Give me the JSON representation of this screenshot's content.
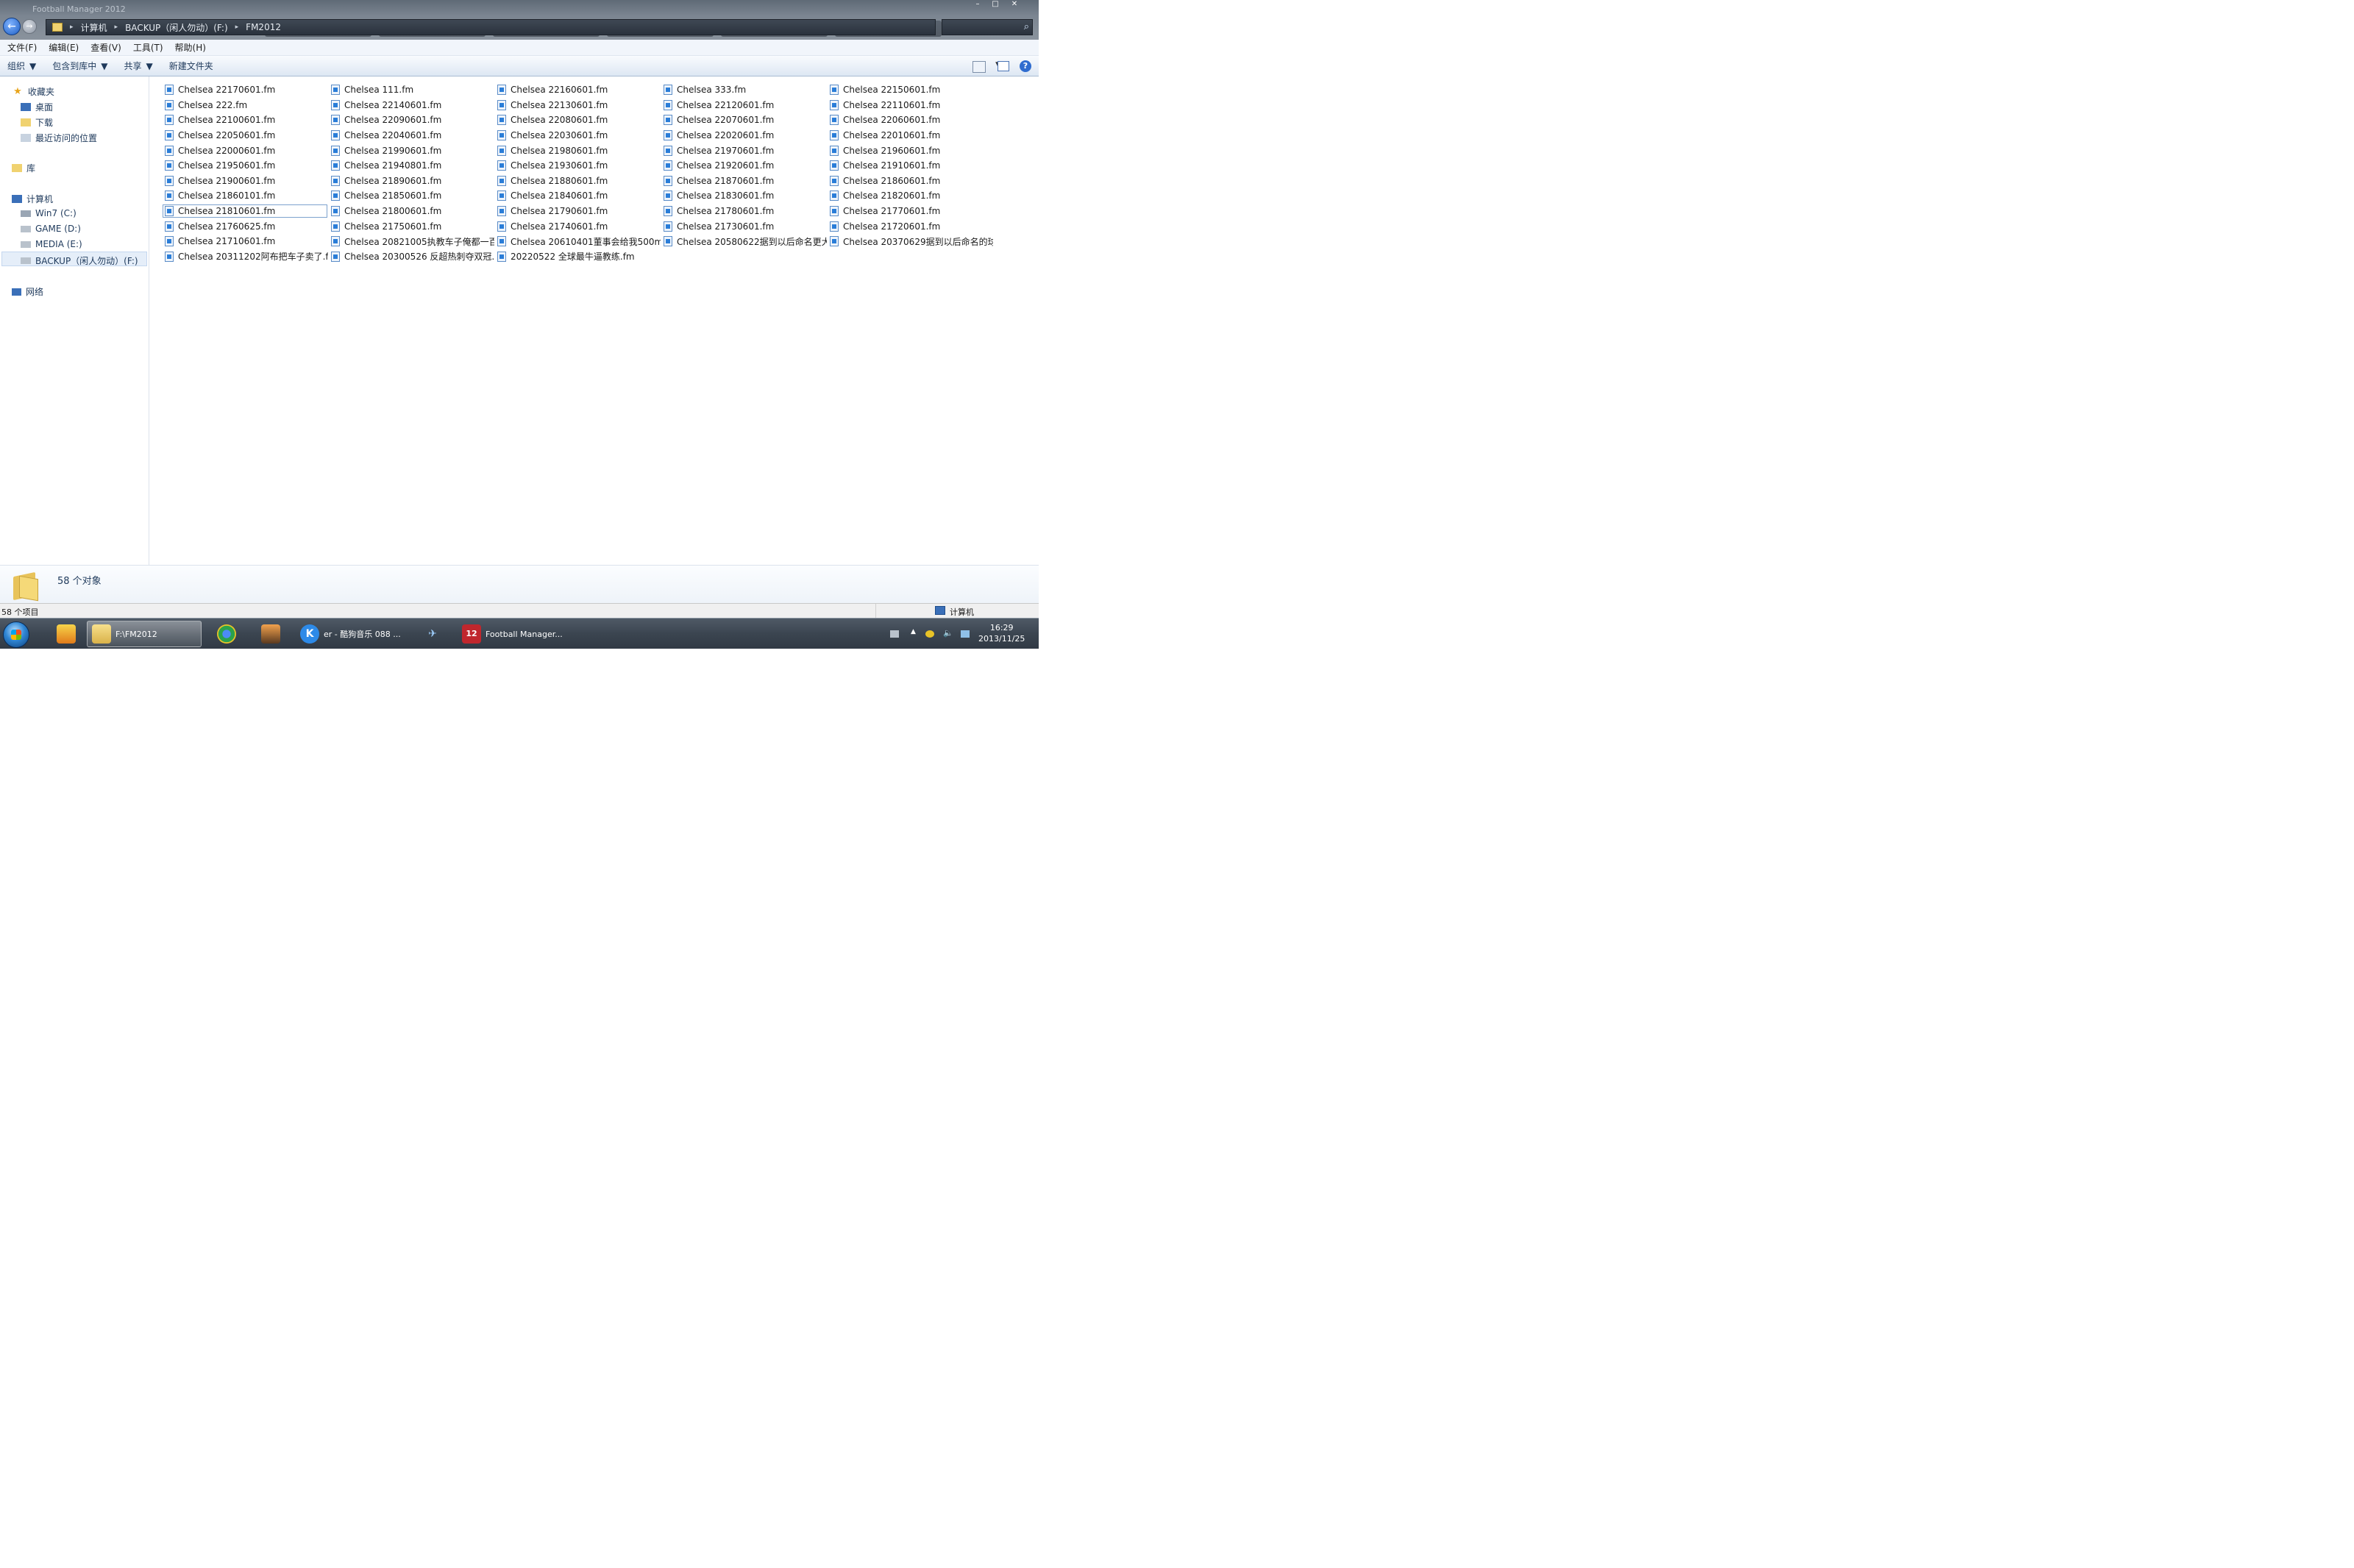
{
  "window": {
    "title": "Football Manager 2012",
    "caption": {
      "minimize": "–",
      "maximize": "□",
      "close": "✕"
    },
    "nav_back": "←",
    "nav_fwd": "→"
  },
  "address": {
    "segments": [
      "计算机",
      "BACKUP（闲人勿动）(F:)",
      "FM2012"
    ],
    "separator": "▸"
  },
  "search": {
    "icon": "search-icon"
  },
  "menubar": [
    "文件(F)",
    "编辑(E)",
    "查看(V)",
    "工具(T)",
    "帮助(H)"
  ],
  "commandbar": {
    "organize": "组织",
    "include_library": "包含到库中",
    "share": "共享",
    "new_folder": "新建文件夹",
    "help": "?"
  },
  "navpane": {
    "favorites": "收藏夹",
    "desktop": "桌面",
    "downloads": "下载",
    "recent": "最近访问的位置",
    "libraries": "库",
    "computer": "计算机",
    "drives": [
      "Win7 (C:)",
      "GAME (D:)",
      "MEDIA (E:)",
      "BACKUP（闲人勿动）(F:)"
    ],
    "network": "网络"
  },
  "files": [
    "Chelsea 22170601.fm",
    "Chelsea 111.fm",
    "Chelsea 22160601.fm",
    "Chelsea 333.fm",
    "Chelsea 22150601.fm",
    "Chelsea 222.fm",
    "Chelsea 22140601.fm",
    "Chelsea 22130601.fm",
    "Chelsea 22120601.fm",
    "Chelsea 22110601.fm",
    "Chelsea 22100601.fm",
    "Chelsea 22090601.fm",
    "Chelsea 22080601.fm",
    "Chelsea 22070601.fm",
    "Chelsea 22060601.fm",
    "Chelsea 22050601.fm",
    "Chelsea 22040601.fm",
    "Chelsea 22030601.fm",
    "Chelsea 22020601.fm",
    "Chelsea 22010601.fm",
    "Chelsea 22000601.fm",
    "Chelsea 21990601.fm",
    "Chelsea 21980601.fm",
    "Chelsea 21970601.fm",
    "Chelsea 21960601.fm",
    "Chelsea 21950601.fm",
    "Chelsea 21940801.fm",
    "Chelsea 21930601.fm",
    "Chelsea 21920601.fm",
    "Chelsea 21910601.fm",
    "Chelsea 21900601.fm",
    "Chelsea 21890601.fm",
    "Chelsea 21880601.fm",
    "Chelsea 21870601.fm",
    "Chelsea 21860601.fm",
    "Chelsea 21860101.fm",
    "Chelsea 21850601.fm",
    "Chelsea 21840601.fm",
    "Chelsea 21830601.fm",
    "Chelsea 21820601.fm",
    "Chelsea 21810601.fm",
    "Chelsea 21800601.fm",
    "Chelsea 21790601.fm",
    "Chelsea 21780601.fm",
    "Chelsea 21770601.fm",
    "Chelsea 21760625.fm",
    "Chelsea 21750601.fm",
    "Chelsea 21740601.fm",
    "Chelsea 21730601.fm",
    "Chelsea 21720601.fm",
    "Chelsea 21710601.fm",
    "Chelsea 20821005执教车子俺都一百...",
    "Chelsea 20610401董事会给我500m资...",
    "Chelsea 20580622据到以后命名更大...",
    "Chelsea 20370629据到以后命名的球...",
    "Chelsea 20311202阿布把车子卖了.fm",
    "Chelsea 20300526 反超热刺夺双冠.fm",
    "20220522 全球最牛逼教练.fm"
  ],
  "details": {
    "count": "58 个对象"
  },
  "status": {
    "left": "58 个项目",
    "right": "计算机"
  },
  "taskbar": {
    "buttons": [
      {
        "label": "F:\\FM2012",
        "icon": "folder-icon"
      },
      {
        "label": "",
        "icon": "chrome-icon"
      },
      {
        "label": "",
        "icon": "game-icon"
      },
      {
        "label": "er - 酷狗音乐 088 ...",
        "icon": "kugou-icon"
      },
      {
        "label": "",
        "icon": "plane-icon"
      },
      {
        "label": "Football Manager...",
        "icon": "fm12-icon",
        "glyph": "12"
      }
    ],
    "clock_time": "16:29",
    "clock_date": "2013/11/25"
  },
  "colors": {
    "accent": "#2a7dd8",
    "taskbar": "#3b4550",
    "fm_red": "#c0272d"
  }
}
